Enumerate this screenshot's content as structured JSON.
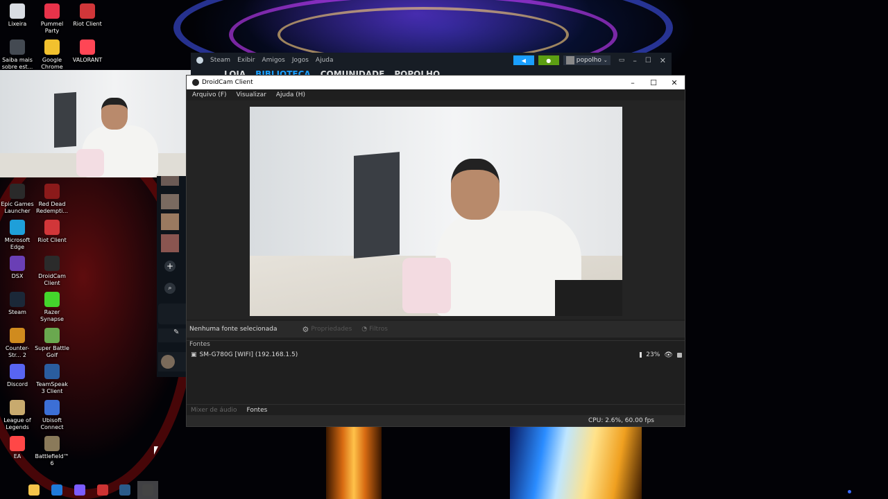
{
  "desktop_icons": [
    {
      "label": "Lixeira",
      "icon": "recycle-bin-icon",
      "color": "#d9dde3"
    },
    {
      "label": "Pummel Party",
      "icon": "pummel-party-icon",
      "color": "#e8334a"
    },
    {
      "label": "Riot Client",
      "icon": "riot-client-icon",
      "color": "#d13639"
    },
    {
      "label": "Saiba mais sobre est...",
      "icon": "learn-more-icon",
      "color": "#444a52"
    },
    {
      "label": "Google Chrome",
      "icon": "chrome-icon",
      "color": "#f2c12e"
    },
    {
      "label": "VALORANT",
      "icon": "valorant-icon",
      "color": "#ff4655"
    },
    {
      "label": "Epic Games Launcher",
      "icon": "epic-games-icon",
      "color": "#2a2a2a"
    },
    {
      "label": "Red Dead Redempti...",
      "icon": "red-dead-icon",
      "color": "#8b1a1a"
    },
    {
      "label": "Microsoft Edge",
      "icon": "edge-icon",
      "color": "#1f9fd9"
    },
    {
      "label": "Riot Client",
      "icon": "riot-client-icon",
      "color": "#d13639"
    },
    {
      "label": "DSX",
      "icon": "dsx-icon",
      "color": "#6a3fb5"
    },
    {
      "label": "DroidCam Client",
      "icon": "droidcam-icon",
      "color": "#2b2b2b"
    },
    {
      "label": "Steam",
      "icon": "steam-icon",
      "color": "#1b2838"
    },
    {
      "label": "Razer Synapse",
      "icon": "razer-icon",
      "color": "#44d62c"
    },
    {
      "label": "Counter-Str... 2",
      "icon": "cs2-icon",
      "color": "#d08b1e"
    },
    {
      "label": "Super Battle Golf",
      "icon": "golf-icon",
      "color": "#6aa84f"
    },
    {
      "label": "Discord",
      "icon": "discord-icon",
      "color": "#5865f2"
    },
    {
      "label": "TeamSpeak 3 Client",
      "icon": "teamspeak-icon",
      "color": "#2a5d9f"
    },
    {
      "label": "League of Legends",
      "icon": "lol-icon",
      "color": "#c8aa6e"
    },
    {
      "label": "Ubisoft Connect",
      "icon": "ubisoft-icon",
      "color": "#3c6fd6"
    },
    {
      "label": "EA",
      "icon": "ea-icon",
      "color": "#ff4747"
    },
    {
      "label": "Battlefield™ 6",
      "icon": "battlefield-icon",
      "color": "#8a7a5a"
    }
  ],
  "steam": {
    "menu": [
      "Steam",
      "Exibir",
      "Amigos",
      "Jogos",
      "Ajuda"
    ],
    "nav": [
      "LOJA",
      "BIBLIOTECA",
      "COMUNIDADE",
      "POPOLHO"
    ],
    "active_nav": "BIBLIOTECA",
    "username": "popolho",
    "accent": "#1a9fff",
    "notif_green": "#5c9e13"
  },
  "droidcam": {
    "title": "DroidCam Client",
    "menu": [
      "Arquivo (F)",
      "Visualizar",
      "Ajuda (H)"
    ],
    "no_source": "Nenhuma fonte selecionada",
    "properties": "Propriedades",
    "filters": "Filtros",
    "sources_header": "Fontes",
    "source_name": "SM-G780G [WIFI] (192.168.1.5)",
    "battery": "23%",
    "tabs": [
      "Mixer de áudio",
      "Fontes"
    ],
    "active_tab": "Fontes",
    "status": "CPU: 2.6%, 60.00 fps"
  },
  "taskbar": [
    {
      "icon": "file-explorer-icon",
      "color": "#f4c44b"
    },
    {
      "icon": "outlook-icon",
      "color": "#1f7ad9"
    },
    {
      "icon": "browser-icon",
      "color": "#7b5cff"
    },
    {
      "icon": "razer-cortex-icon",
      "color": "#c33"
    },
    {
      "icon": "steam-taskbar-icon",
      "color": "#2a5b8a"
    },
    {
      "icon": "droidcam-taskbar-icon",
      "color": "#444"
    }
  ]
}
